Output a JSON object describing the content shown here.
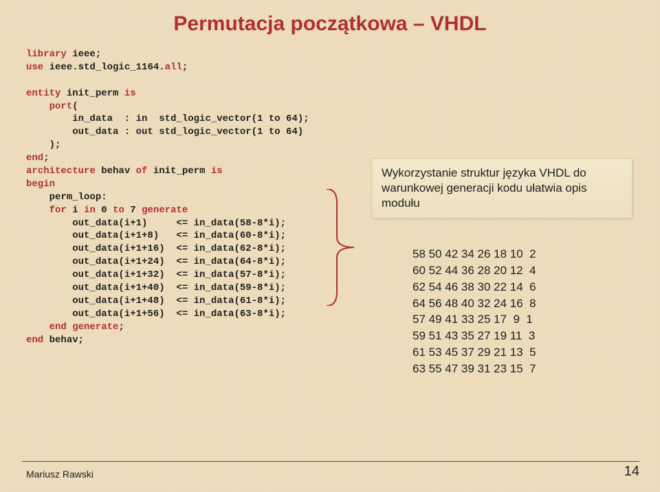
{
  "title": "Permutacja początkowa – VHDL",
  "code": {
    "l1a": "library",
    "l1b": " ieee;",
    "l2a": "use",
    "l2b": " ieee.std_logic_1164.",
    "l2c": "all",
    "l2d": ";",
    "l3a": "entity",
    "l3b": " init_perm ",
    "l3c": "is",
    "l4a": "port",
    "l4b": "(",
    "l5": "        in_data  : in  std_logic_vector(1 to 64);",
    "l6": "        out_data : out std_logic_vector(1 to 64)",
    "l7": "    );",
    "l8a": "end",
    "l8b": ";",
    "l9a": "architecture",
    "l9b": " behav ",
    "l9c": "of",
    "l9d": " init_perm ",
    "l9e": "is",
    "l10": "begin",
    "l11": "    perm_loop:",
    "l12a": "    ",
    "l12b": "for",
    "l12c": " i ",
    "l12d": "in",
    "l12e": " 0 ",
    "l12f": "to",
    "l12g": " 7 ",
    "l12h": "generate",
    "l13": "        out_data(i+1)     <= in_data(58-8*i);",
    "l14": "        out_data(i+1+8)   <= in_data(60-8*i);",
    "l15": "        out_data(i+1+16)  <= in_data(62-8*i);",
    "l16": "        out_data(i+1+24)  <= in_data(64-8*i);",
    "l17": "        out_data(i+1+32)  <= in_data(57-8*i);",
    "l18": "        out_data(i+1+40)  <= in_data(59-8*i);",
    "l19": "        out_data(i+1+48)  <= in_data(61-8*i);",
    "l20": "        out_data(i+1+56)  <= in_data(63-8*i);",
    "l21a": "    ",
    "l21b": "end generate",
    "l21c": ";",
    "l22a": "end",
    "l22b": " behav;"
  },
  "desc": "Wykorzystanie struktur języka VHDL do warunkowej generacji kodu ułatwia opis modułu",
  "matrix": [
    "58 50 42 34 26 18 10  2",
    "60 52 44 36 28 20 12  4",
    "62 54 46 38 30 22 14  6",
    "64 56 48 40 32 24 16  8",
    "57 49 41 33 25 17  9  1",
    "59 51 43 35 27 19 11  3",
    "61 53 45 37 29 21 13  5",
    "63 55 47 39 31 23 15  7"
  ],
  "footer": {
    "author": "Mariusz Rawski",
    "page": "14"
  }
}
